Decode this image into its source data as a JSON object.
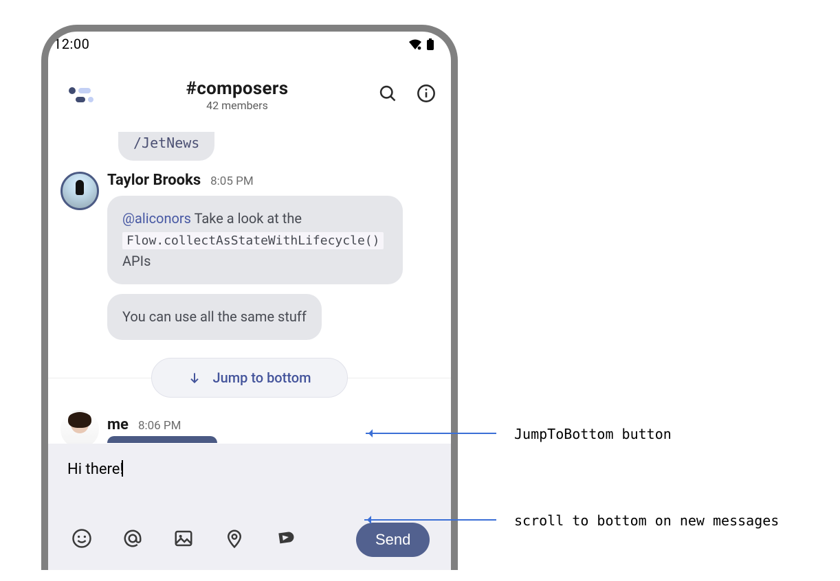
{
  "status": {
    "time": "12:00"
  },
  "header": {
    "channel": "#composers",
    "members": "42 members"
  },
  "messages": {
    "partial_top": "/JetNews",
    "taylor": {
      "author": "Taylor Brooks",
      "time": "8:05 PM",
      "bubble1_mention": "@aliconors",
      "bubble1_text_before": " Take a look at the ",
      "bubble1_code": "Flow.collectAsStateWithLifecycle()",
      "bubble1_text_after": " APIs",
      "bubble2": "You can use all the same stuff"
    },
    "jump_label": "Jump to bottom",
    "me": {
      "author": "me",
      "time": "8:06 PM"
    }
  },
  "composer": {
    "draft": "Hi there!",
    "send": "Send"
  },
  "annotations": {
    "a1": "JumpToBottom button",
    "a2": "scroll to bottom on new messages"
  }
}
